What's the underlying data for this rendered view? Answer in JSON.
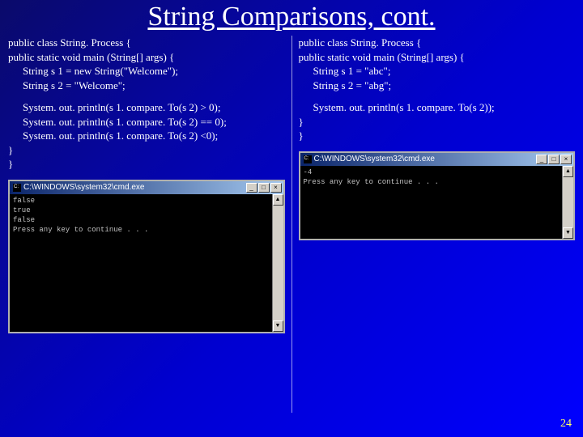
{
  "title": "String Comparisons, cont.",
  "left": {
    "code": {
      "l1": "public class String. Process {",
      "l2": "public static void main (String[] args) {",
      "l3": "String s 1 = new String(\"Welcome\");",
      "l4": "String s 2 = \"Welcome\";",
      "l5": "System. out. println(s 1. compare. To(s 2) > 0);",
      "l6": "System. out. println(s 1. compare. To(s 2) == 0);",
      "l7": "System. out. println(s 1. compare. To(s 2) <0);",
      "l8": "}",
      "l9": "}"
    },
    "console": {
      "title": "C:\\WINDOWS\\system32\\cmd.exe",
      "output": "false\ntrue\nfalse\nPress any key to continue . . ."
    }
  },
  "right": {
    "code": {
      "l1": "public class String. Process {",
      "l2": "public static void main (String[] args) {",
      "l3": "String s 1 = \"abc\";",
      "l4": "String s 2 = \"abg\";",
      "l5": "System. out. println(s 1. compare. To(s 2));",
      "l6": "}",
      "l7": "}"
    },
    "console": {
      "title": "C:\\WINDOWS\\system32\\cmd.exe",
      "output": "-4\nPress any key to continue . . ."
    }
  },
  "winbtns": {
    "min": "_",
    "max": "□",
    "close": "×"
  },
  "scroll": {
    "up": "▲",
    "down": "▼"
  },
  "pagenum": "24"
}
